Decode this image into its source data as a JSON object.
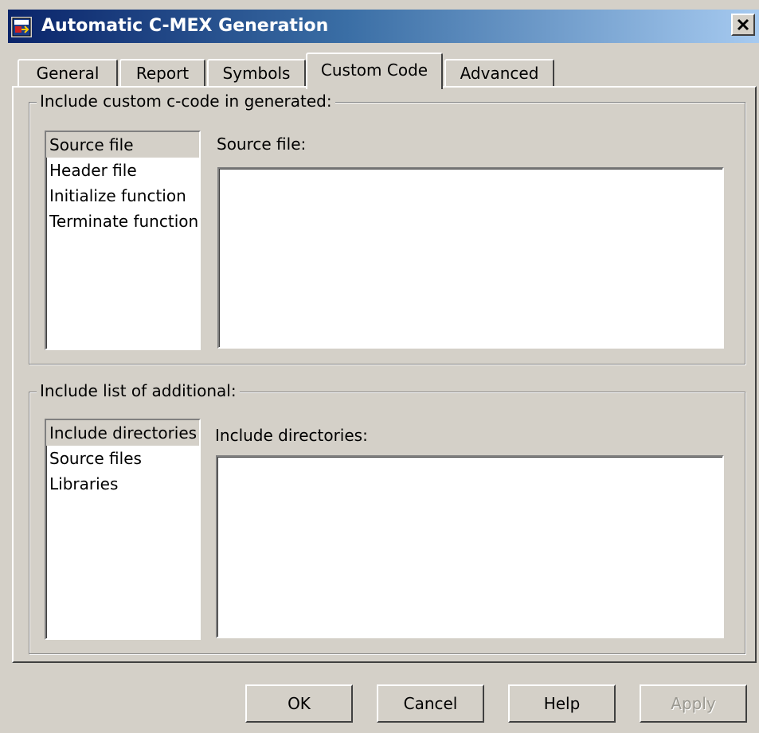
{
  "window": {
    "title": "Automatic C-MEX Generation"
  },
  "icons": {
    "app": "simulink-model-icon",
    "close": "close-x-icon"
  },
  "tabs": [
    {
      "label": "General",
      "active": false
    },
    {
      "label": "Report",
      "active": false
    },
    {
      "label": "Symbols",
      "active": false
    },
    {
      "label": "Custom Code",
      "active": true
    },
    {
      "label": "Advanced",
      "active": false
    }
  ],
  "custom_code": {
    "group_title": "Include custom c-code in generated:",
    "items": [
      "Source file",
      "Header file",
      "Initialize function",
      "Terminate function"
    ],
    "selected": "Source file",
    "field_label": "Source file:",
    "field_value": ""
  },
  "additional": {
    "group_title": "Include list of additional:",
    "items": [
      "Include directories",
      "Source files",
      "Libraries"
    ],
    "selected": "Include directories",
    "field_label": "Include directories:",
    "field_value": ""
  },
  "buttons": {
    "ok": "OK",
    "cancel": "Cancel",
    "help": "Help",
    "apply": "Apply",
    "apply_enabled": false
  },
  "colors": {
    "face": "#d4d0c8",
    "title_dark": "#0a246a",
    "title_light": "#a6caf0",
    "disabled_text": "#9a9890"
  }
}
